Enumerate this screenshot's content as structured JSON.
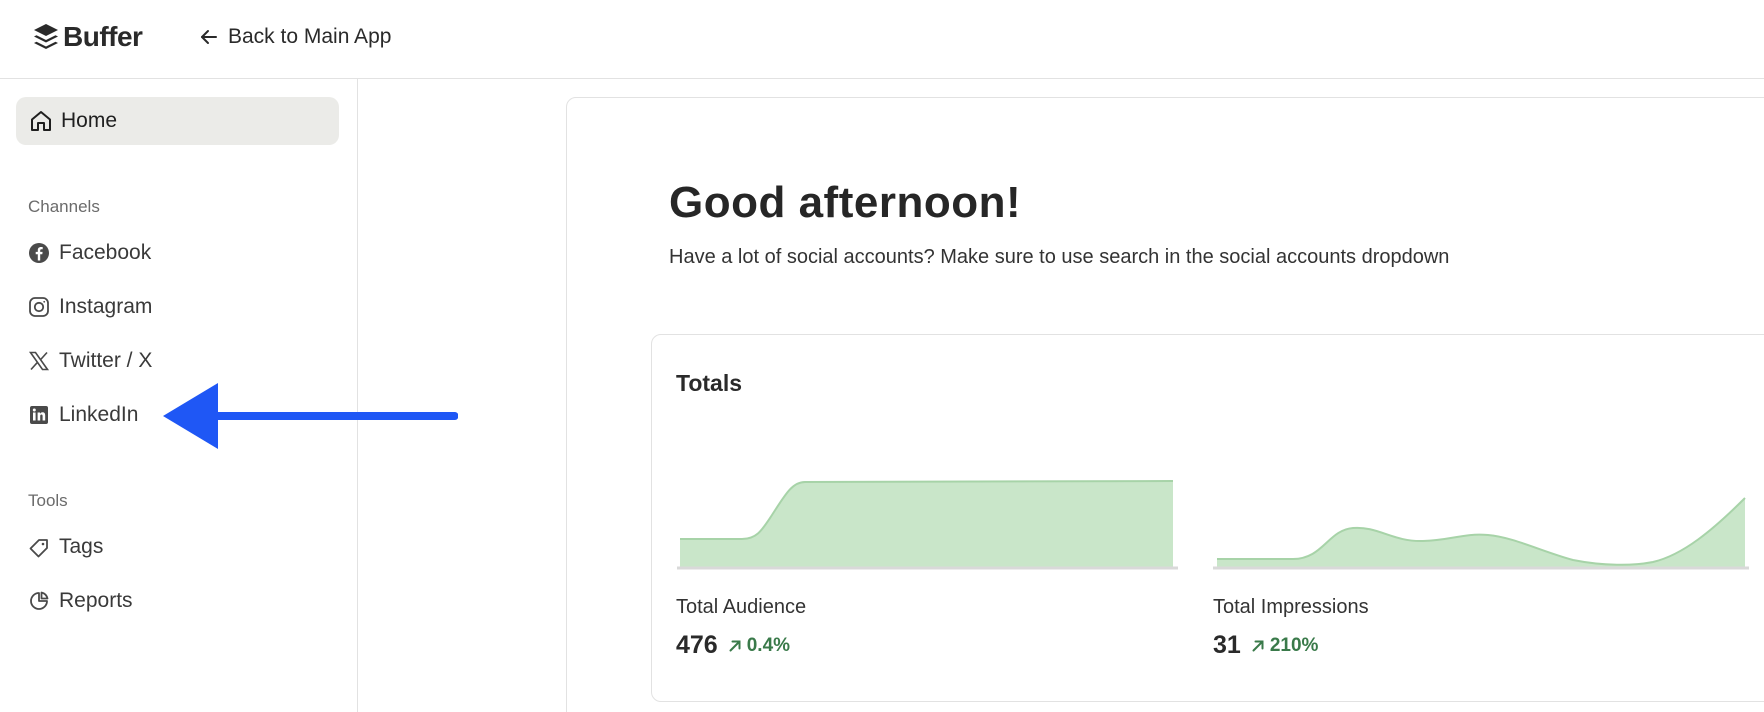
{
  "header": {
    "logo_text": "Buffer",
    "back_label": "Back to Main App"
  },
  "sidebar": {
    "home_label": "Home",
    "channels_label": "Channels",
    "channels": [
      {
        "label": "Facebook",
        "icon": "facebook-icon"
      },
      {
        "label": "Instagram",
        "icon": "instagram-icon"
      },
      {
        "label": "Twitter / X",
        "icon": "x-twitter-icon"
      },
      {
        "label": "LinkedIn",
        "icon": "linkedin-icon"
      }
    ],
    "tools_label": "Tools",
    "tools": [
      {
        "label": "Tags",
        "icon": "tag-icon"
      },
      {
        "label": "Reports",
        "icon": "pie-chart-icon"
      }
    ]
  },
  "main": {
    "greeting": "Good afternoon!",
    "subtitle": "Have a lot of social accounts? Make sure to use search in the social accounts dropdown",
    "totals": {
      "title": "Totals",
      "metrics": [
        {
          "label": "Total Audience",
          "value": "476",
          "change": "0.4%"
        },
        {
          "label": "Total Impressions",
          "value": "31",
          "change": "210%"
        }
      ]
    }
  },
  "colors": {
    "accent_arrow": "#1f57f5",
    "spark_fill": "#c9e6c9",
    "spark_line": "#a7d3a8",
    "positive": "#3a7a4a",
    "home_bg": "#ebebe8"
  }
}
